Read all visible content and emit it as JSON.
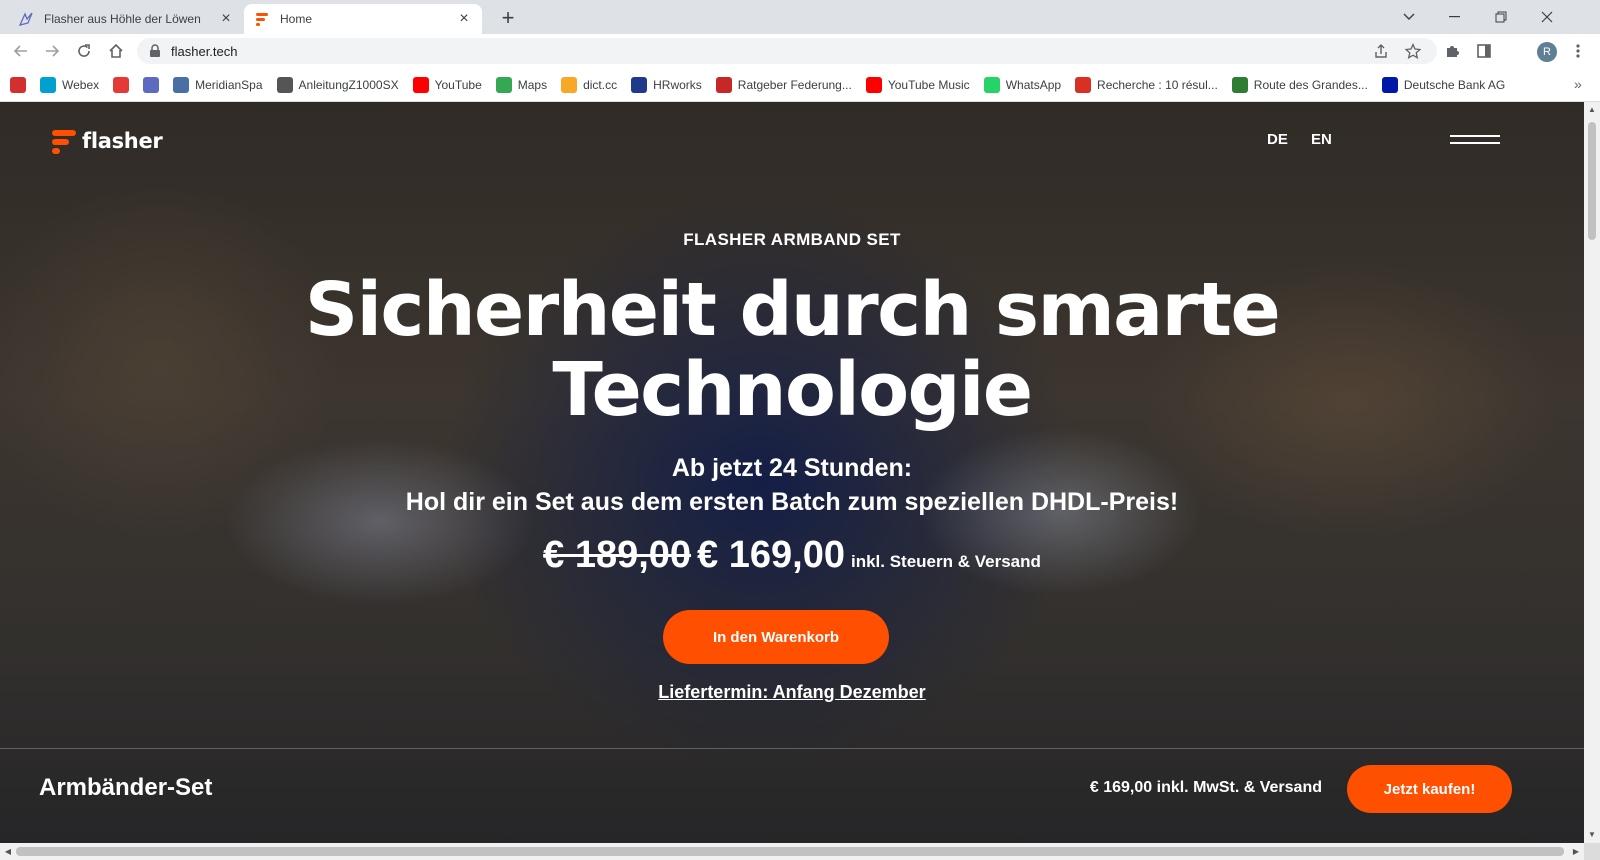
{
  "browser": {
    "tabs": [
      {
        "title": "Flasher aus Höhle der Löwen",
        "active": false
      },
      {
        "title": "Home",
        "active": true
      }
    ],
    "new_tab_icon": "plus-icon",
    "address": {
      "url": "flasher.tech"
    },
    "avatar_letter": "R",
    "bookmarks": [
      {
        "label": "",
        "icon": "k-icon",
        "color": "#d32f2f"
      },
      {
        "label": "Webex",
        "icon": "webex-icon",
        "color": "#00a0d1"
      },
      {
        "label": "",
        "icon": "shopping-bag-icon",
        "color": "#e53935"
      },
      {
        "label": "",
        "icon": "flasher-bird-icon",
        "color": "#5c6bc0"
      },
      {
        "label": "MeridianSpa",
        "icon": "meridian-icon",
        "color": "#4a6fa5"
      },
      {
        "label": "AnleitungZ1000SX",
        "icon": "globe-icon",
        "color": "#555555"
      },
      {
        "label": "YouTube",
        "icon": "youtube-icon",
        "color": "#ff0000"
      },
      {
        "label": "Maps",
        "icon": "maps-pin-icon",
        "color": "#34a853"
      },
      {
        "label": "dict.cc",
        "icon": "dictcc-icon",
        "color": "#f9a825"
      },
      {
        "label": "HRworks",
        "icon": "hrworks-icon",
        "color": "#1e3a8a"
      },
      {
        "label": "Ratgeber Federung...",
        "icon": "m-icon",
        "color": "#c62828"
      },
      {
        "label": "YouTube Music",
        "icon": "youtube-music-icon",
        "color": "#ff0000"
      },
      {
        "label": "WhatsApp",
        "icon": "whatsapp-icon",
        "color": "#25d366"
      },
      {
        "label": "Recherche : 10 résul...",
        "icon": "gmail-icon",
        "color": "#d93025"
      },
      {
        "label": "Route des Grandes...",
        "icon": "route-icon",
        "color": "#2e7d32"
      },
      {
        "label": "Deutsche Bank AG",
        "icon": "deutsche-bank-icon",
        "color": "#0018a8"
      }
    ]
  },
  "site": {
    "logo_text": "flasher",
    "languages": [
      "DE",
      "EN"
    ],
    "kicker": "FLASHER ARMBAND SET",
    "headline_line1": "Sicherheit durch smarte",
    "headline_line2": "Technologie",
    "sub_line1": "Ab jetzt 24 Stunden:",
    "sub_line2": "Hol dir ein Set aus dem ersten Batch zum speziellen DHDL-Preis!",
    "old_price": "€ 189,00",
    "new_price": "€ 169,00",
    "price_note": "inkl. Steuern & Versand",
    "cart_button": "In den Warenkorb",
    "delivery_link": "Liefertermin: Anfang Dezember",
    "bottom_title": "Armbänder-Set",
    "bottom_price": "€ 169,00 inkl. MwSt. & Versand",
    "buy_button": "Jetzt kaufen!",
    "accent_color": "#ff4f00"
  }
}
